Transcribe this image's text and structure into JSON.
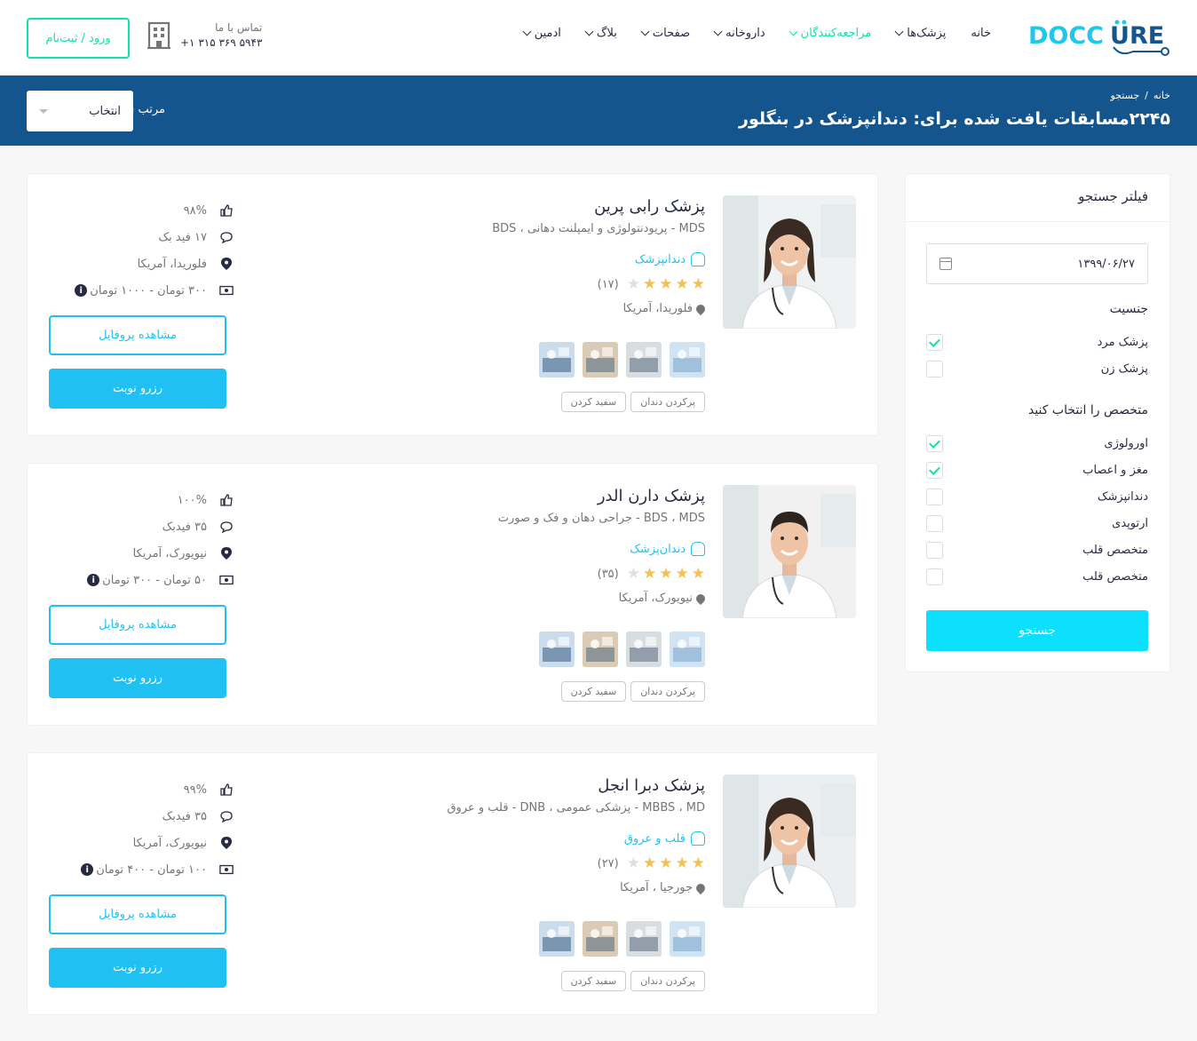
{
  "header": {
    "nav": [
      {
        "label": "خانه",
        "chevron": false
      },
      {
        "label": "پزشک‌ها",
        "chevron": true
      },
      {
        "label": "مراجعه‌کنندگان",
        "chevron": true,
        "active": true
      },
      {
        "label": "داروخانه",
        "chevron": true
      },
      {
        "label": "صفحات",
        "chevron": true
      },
      {
        "label": "بلاگ",
        "chevron": true
      },
      {
        "label": "ادمین",
        "chevron": true
      }
    ],
    "contact_label": "تماس با ما",
    "contact_phone": "+۱ ۳۱۵ ۳۶۹ ۵۹۴۳",
    "login_label": "ورود / ثبت‌نام"
  },
  "bcbar": {
    "breadcrumb_home": "خانه",
    "breadcrumb_sep": "/",
    "breadcrumb_current": "جستجو",
    "title": "۲۲۴۵مسابقات یافت شده برای: دندانپزشک در بنگلور",
    "sort_label": "مرتب سازی",
    "sort_value": "انتخاب"
  },
  "filter": {
    "title": "فیلتر جستجو",
    "date_value": "۱۳۹۹/۰۶/۲۷",
    "gender_title": "جنسیت",
    "gender": [
      {
        "label": "پزشک مرد",
        "checked": true
      },
      {
        "label": "پزشک زن",
        "checked": false
      }
    ],
    "spec_title": "متخصص را انتخاب کنید",
    "specialties": [
      {
        "label": "اورولوژی",
        "checked": true
      },
      {
        "label": "مغز و اعصاب",
        "checked": true
      },
      {
        "label": "دندانپزشک",
        "checked": false
      },
      {
        "label": "ارتوپدی",
        "checked": false
      },
      {
        "label": "متخصص قلب",
        "checked": false
      },
      {
        "label": "متخصص قلب",
        "checked": false
      }
    ],
    "search_label": "جستجو"
  },
  "doctors": [
    {
      "name": "پزشک رابی پرین",
      "degrees": "MDS - پریودنتولوژی و ایمپلنت دهانی ، BDS",
      "specialty": "دندانپزشک",
      "rating": 4,
      "reviews": "(۱۷)",
      "location": "فلوریدا، آمریکا",
      "tags": [
        "پرکردن دندان",
        "سفید کردن"
      ],
      "like": "۹۸%",
      "feedback": "۱۷ فید بک",
      "place": "فلوریدا، آمریکا",
      "price": "۳۰۰ تومان - ۱۰۰۰ تومان",
      "profile_label": "مشاهده پروفایل",
      "book_label": "رزرو نوبت",
      "gender": "female"
    },
    {
      "name": "پزشک دارن الدر",
      "degrees": "BDS ، MDS - جراحی دهان و فک و صورت",
      "specialty": "دندان‌پزشک",
      "rating": 4,
      "reviews": "(۳۵)",
      "location": "نیویورک، آمریکا",
      "tags": [
        "پرکردن دندان",
        "سفید کردن"
      ],
      "like": "۱۰۰%",
      "feedback": "۳۵ فیدبک",
      "place": "نیویورک، آمریکا",
      "price": "۵۰ تومان - ۳۰۰ تومان",
      "profile_label": "مشاهده پروفایل",
      "book_label": "رزرو نوبت",
      "gender": "male"
    },
    {
      "name": "پزشک دبرا انجل",
      "degrees": "MBBS ، MD - پزشکی عمومی ، DNB - قلب و عروق",
      "specialty": "قلب و عروق",
      "rating": 4,
      "reviews": "(۲۷)",
      "location": "جورجیا ، آمریکا",
      "tags": [
        "پرکردن دندان",
        "سفید کردن"
      ],
      "like": "۹۹%",
      "feedback": "۳۵ فیدبک",
      "place": "نیویورک، آمریکا",
      "price": "۱۰۰ تومان - ۴۰۰ تومان",
      "profile_label": "مشاهده پروفایل",
      "book_label": "رزرو نوبت",
      "gender": "female"
    }
  ],
  "colors": {
    "primary": "#15558d",
    "accent": "#09e5ab",
    "blue": "#20c0f3",
    "star": "#f4c150"
  }
}
